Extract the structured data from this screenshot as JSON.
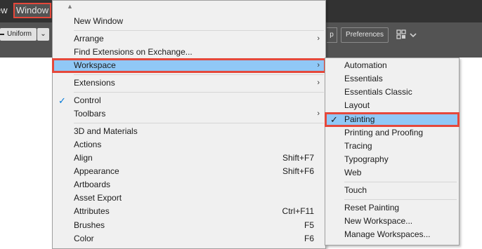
{
  "menubar": {
    "partial_label": "ew",
    "window_label": "Window"
  },
  "toolbar": {
    "stroke_profile": "Uniform",
    "p_label": "p",
    "preferences_label": "Preferences",
    "arrange_icon": "arrange-documents-icon"
  },
  "window_menu": {
    "top_arrow": "▲",
    "items": [
      {
        "label": "New Window"
      },
      {
        "label": "Arrange",
        "submenu": "›"
      },
      {
        "label": "Find Extensions on Exchange..."
      },
      {
        "label": "Workspace",
        "submenu": "›"
      },
      {
        "label": "Extensions",
        "submenu": "›"
      },
      {
        "label": "Control",
        "checked": "✓"
      },
      {
        "label": "Toolbars",
        "submenu": "›"
      },
      {
        "label": "3D and Materials"
      },
      {
        "label": "Actions"
      },
      {
        "label": "Align",
        "shortcut": "Shift+F7"
      },
      {
        "label": "Appearance",
        "shortcut": "Shift+F6"
      },
      {
        "label": "Artboards"
      },
      {
        "label": "Asset Export"
      },
      {
        "label": "Attributes",
        "shortcut": "Ctrl+F11"
      },
      {
        "label": "Brushes",
        "shortcut": "F5"
      },
      {
        "label": "Color",
        "shortcut": "F6"
      }
    ]
  },
  "workspace_submenu": {
    "items": [
      {
        "label": "Automation"
      },
      {
        "label": "Essentials"
      },
      {
        "label": "Essentials Classic"
      },
      {
        "label": "Layout"
      },
      {
        "label": "Painting",
        "checked": "✓"
      },
      {
        "label": "Printing and Proofing"
      },
      {
        "label": "Tracing"
      },
      {
        "label": "Typography"
      },
      {
        "label": "Web"
      },
      {
        "label": "Touch"
      },
      {
        "label": "Reset Painting"
      },
      {
        "label": "New Workspace..."
      },
      {
        "label": "Manage Workspaces..."
      }
    ]
  },
  "colors": {
    "highlight": "#90c8f6",
    "annotation_border": "#e5483b",
    "menubar": "#323232",
    "toolbar": "#535353"
  }
}
